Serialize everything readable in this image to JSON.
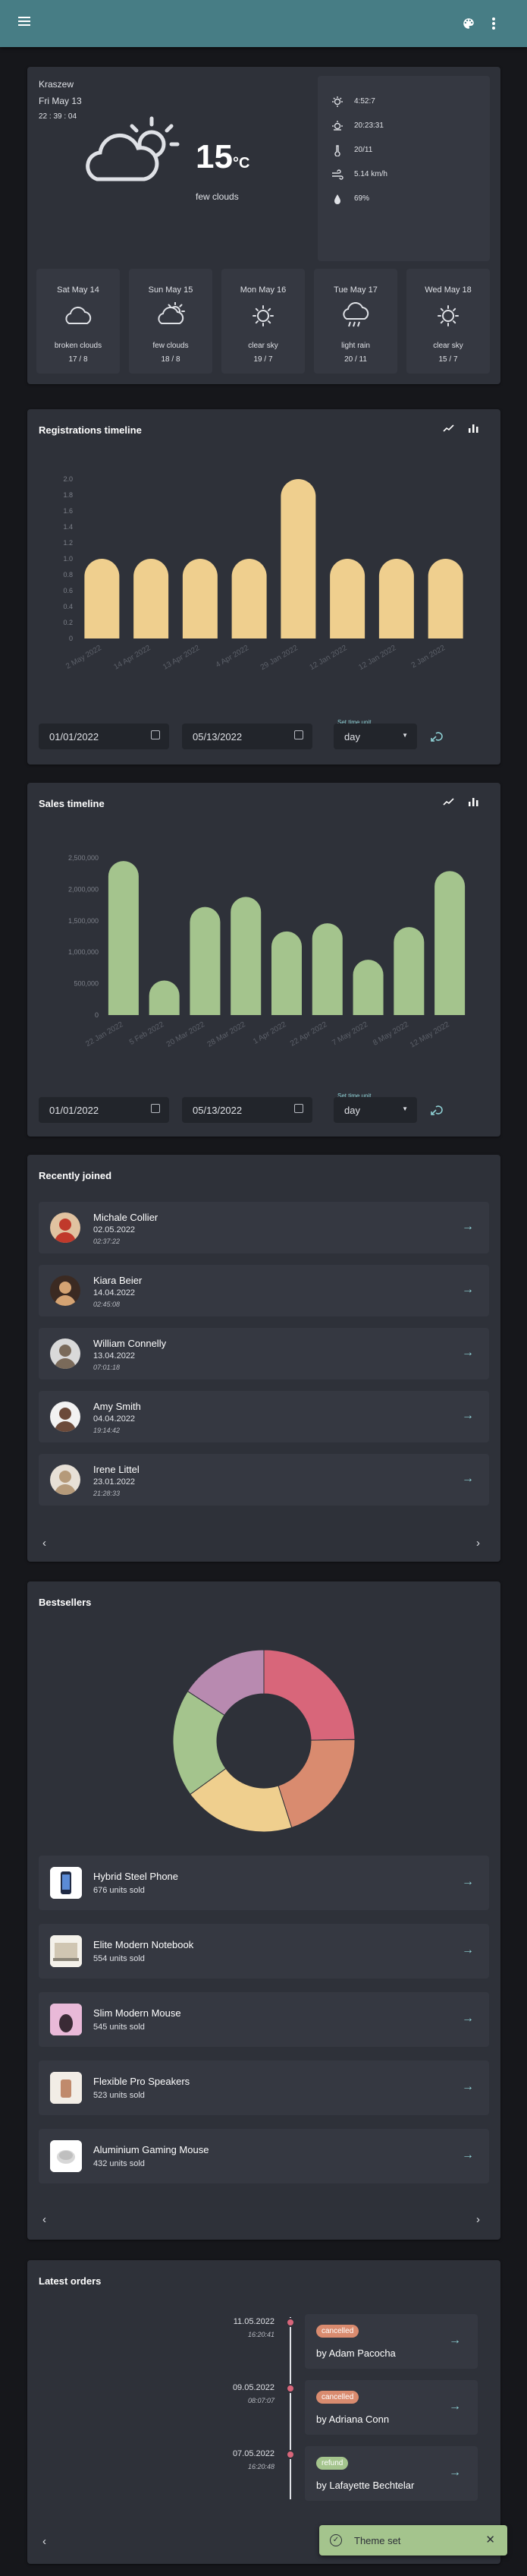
{
  "topbar": {
    "color": "#477d85",
    "palette_icon": "palette-icon",
    "menu_icon": "more-vert-icon",
    "hamburger_icon": "menu-icon"
  },
  "weather": {
    "city": "Kraszew",
    "date": "Fri May 13",
    "time": "22 : 39 : 04",
    "temp": "15",
    "unit": "°C",
    "desc": "few clouds",
    "details": [
      {
        "icon": "sunrise-icon",
        "value": "4:52:7"
      },
      {
        "icon": "sunset-icon",
        "value": "20:23:31"
      },
      {
        "icon": "thermometer-icon",
        "value": "20/11"
      },
      {
        "icon": "wind-icon",
        "value": "5.14 km/h"
      },
      {
        "icon": "humidity-icon",
        "value": "69%"
      }
    ],
    "forecast": [
      {
        "day": "Sat May 14",
        "desc": "broken clouds",
        "temps": "17 / 8",
        "icon": "cloud-icon"
      },
      {
        "day": "Sun May 15",
        "desc": "few clouds",
        "temps": "18 / 8",
        "icon": "sun-cloud-icon"
      },
      {
        "day": "Mon May 16",
        "desc": "clear sky",
        "temps": "19 / 7",
        "icon": "sun-icon"
      },
      {
        "day": "Tue May 17",
        "desc": "light rain",
        "temps": "20 / 11",
        "icon": "rain-icon"
      },
      {
        "day": "Wed May 18",
        "desc": "clear sky",
        "temps": "15 / 7",
        "icon": "sun-icon"
      }
    ]
  },
  "registrations": {
    "title": "Registrations timeline",
    "date_from": "01/01/2022",
    "date_to": "05/13/2022",
    "unit_label": "Set time unit",
    "unit_value": "day",
    "chart_data": {
      "type": "bar",
      "categories": [
        "2 May 2022",
        "14 Apr 2022",
        "13 Apr 2022",
        "4 Apr 2022",
        "29 Jan 2022",
        "12 Jan 2022",
        "12 Jan 2022",
        "2 Jan 2022"
      ],
      "values": [
        1,
        1,
        1,
        1,
        2,
        1,
        1,
        1
      ],
      "ylim": [
        0,
        2
      ],
      "yticks": [
        "0",
        "0.2",
        "0.4",
        "0.6",
        "0.8",
        "1.0",
        "1.2",
        "1.4",
        "1.6",
        "1.8",
        "2.0"
      ],
      "color": "#efcf8e"
    }
  },
  "sales": {
    "title": "Sales timeline",
    "date_from": "01/01/2022",
    "date_to": "05/13/2022",
    "unit_label": "Set time unit",
    "unit_value": "day",
    "chart_data": {
      "type": "bar",
      "categories": [
        "22 Jan 2022",
        "5 Feb 2022",
        "20 Mar 2022",
        "28 Mar 2022",
        "1 Apr 2022",
        "22 Apr 2022",
        "7 May 2022",
        "8 May 2022",
        "12 May 2022"
      ],
      "values": [
        2450000,
        550000,
        1720000,
        1880000,
        1330000,
        1460000,
        880000,
        1400000,
        2290000
      ],
      "ylim": [
        0,
        2500000
      ],
      "yticks": [
        "0",
        "500,000",
        "1,000,000",
        "1,500,000",
        "2,000,000",
        "2,500,000"
      ],
      "color": "#a4c48d"
    }
  },
  "recent": {
    "title": "Recently joined",
    "users": [
      {
        "name": "Michale Collier",
        "date": "02.05.2022",
        "time": "02:37:22"
      },
      {
        "name": "Kiara Beier",
        "date": "14.04.2022",
        "time": "02:45:08"
      },
      {
        "name": "William Connelly",
        "date": "13.04.2022",
        "time": "07:01:18"
      },
      {
        "name": "Amy Smith",
        "date": "04.04.2022",
        "time": "19:14:42"
      },
      {
        "name": "Irene Littel",
        "date": "23.01.2022",
        "time": "21:28:33"
      }
    ]
  },
  "bestsellers": {
    "title": "Bestsellers",
    "chart_data": {
      "type": "pie",
      "labels": [
        "Hybrid Steel Phone",
        "Elite Modern Notebook",
        "Slim Modern Mouse",
        "Flexible Pro Speakers",
        "Aluminium Gaming Mouse"
      ],
      "values": [
        676,
        554,
        545,
        523,
        432
      ],
      "colors": [
        "#d8667a",
        "#d98b6f",
        "#efcf8e",
        "#a4c48d",
        "#b88ab0"
      ]
    },
    "items": [
      {
        "name": "Hybrid Steel Phone",
        "sold": "676 units sold"
      },
      {
        "name": "Elite Modern Notebook",
        "sold": "554 units sold"
      },
      {
        "name": "Slim Modern Mouse",
        "sold": "545 units sold"
      },
      {
        "name": "Flexible Pro Speakers",
        "sold": "523 units sold"
      },
      {
        "name": "Aluminium Gaming Mouse",
        "sold": "432 units sold"
      }
    ]
  },
  "orders": {
    "title": "Latest orders",
    "items": [
      {
        "date": "11.05.2022",
        "time": "16:20:41",
        "status": "cancelled",
        "status_color": "#d98b6f",
        "by": "by Adam Pacocha"
      },
      {
        "date": "09.05.2022",
        "time": "08:07:07",
        "status": "cancelled",
        "status_color": "#d98b6f",
        "by": "by Adriana Conn"
      },
      {
        "date": "07.05.2022",
        "time": "16:20:48",
        "status": "refund",
        "status_color": "#a4c48d",
        "by": "by Lafayette Bechtelar"
      }
    ]
  },
  "toast": {
    "text": "Theme set",
    "color": "#a4c48d"
  }
}
